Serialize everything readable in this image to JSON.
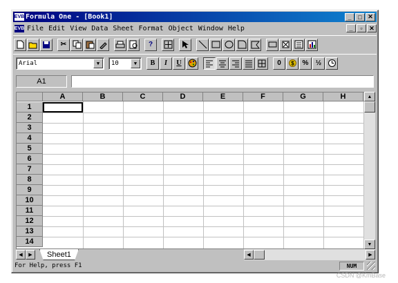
{
  "window": {
    "title": "Formula One - [Book1]",
    "app_icon_text": "EVB"
  },
  "menu": {
    "items": [
      "File",
      "Edit",
      "View",
      "Data",
      "Sheet",
      "Format",
      "Object",
      "Window",
      "Help"
    ]
  },
  "toolbar1": {
    "buttons": [
      "new-document",
      "open-folder",
      "save",
      "cut",
      "copy",
      "paste",
      "format-painter",
      "print",
      "print-preview",
      "help",
      "select-all",
      "pointer",
      "line",
      "rectangle",
      "ellipse",
      "arc",
      "polygon",
      "button-control",
      "checkbox-control",
      "listbox-control",
      "chart"
    ]
  },
  "toolbar2": {
    "font_name": "Arial",
    "font_size": "10",
    "bold": "B",
    "italic": "I",
    "underline": "U",
    "number_label": "0",
    "percent_label": "%",
    "fraction_label": "½"
  },
  "formula_bar": {
    "cell_ref": "A1",
    "content": ""
  },
  "sheet": {
    "columns": [
      "A",
      "B",
      "C",
      "D",
      "E",
      "F",
      "G",
      "H"
    ],
    "rows": [
      "1",
      "2",
      "3",
      "4",
      "5",
      "6",
      "7",
      "8",
      "9",
      "10",
      "11",
      "12",
      "13",
      "14"
    ],
    "active_cell": "A1"
  },
  "tabs": {
    "sheet1": "Sheet1"
  },
  "status": {
    "help_text": "For Help, press F1",
    "num_indicator": "NUM"
  },
  "watermark": "CSDN @KmBase"
}
